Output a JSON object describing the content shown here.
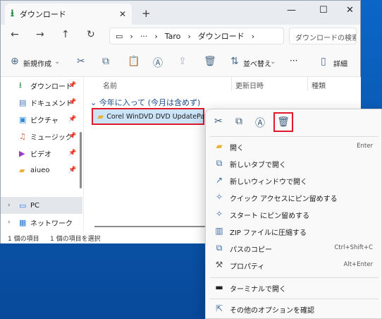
{
  "window": {
    "tab_title": "ダウンロード",
    "new_tab": "+",
    "controls": {
      "minimize": "—",
      "maximize": "☐",
      "close": "✕"
    }
  },
  "nav": {
    "breadcrumb": [
      "Taro",
      "ダウンロード"
    ],
    "more": "···",
    "search_placeholder": "ダウンロードの検索"
  },
  "toolbar": {
    "new_label": "新規作成",
    "sort_label": "並べ替え",
    "more": "···",
    "details_label": "詳細"
  },
  "sidebar": {
    "items": [
      {
        "label": "ダウンロード",
        "icon": "download-icon"
      },
      {
        "label": "ドキュメント",
        "icon": "document-icon"
      },
      {
        "label": "ピクチャ",
        "icon": "picture-icon"
      },
      {
        "label": "ミュージック",
        "icon": "music-icon"
      },
      {
        "label": "ビデオ",
        "icon": "video-icon"
      },
      {
        "label": "aiueo",
        "icon": "folder-icon"
      },
      {
        "label": "PC",
        "icon": "pc-icon"
      },
      {
        "label": "ネットワーク",
        "icon": "network-icon"
      }
    ]
  },
  "content": {
    "columns": [
      "名前",
      "更新日時",
      "種類"
    ],
    "group": "今年に入って (今月は含めず)",
    "file": "Corel WinDVD DVD UpdatePatch"
  },
  "status": {
    "count": "1 個の項目",
    "selected": "1 個の項目を選択"
  },
  "context_menu": {
    "items": [
      {
        "label": "開く",
        "shortcut": "Enter",
        "icon": "open-folder-icon"
      },
      {
        "label": "新しいタブで開く",
        "shortcut": "",
        "icon": "new-tab-icon"
      },
      {
        "label": "新しいウィンドウで開く",
        "shortcut": "",
        "icon": "new-window-icon"
      },
      {
        "label": "クイック アクセスにピン留めする",
        "shortcut": "",
        "icon": "pin-icon"
      },
      {
        "label": "スタート にピン留めする",
        "shortcut": "",
        "icon": "pin-start-icon"
      },
      {
        "label": "ZIP ファイルに圧縮する",
        "shortcut": "",
        "icon": "zip-icon"
      },
      {
        "label": "パスのコピー",
        "shortcut": "Ctrl+Shift+C",
        "icon": "copy-path-icon"
      },
      {
        "label": "プロパティ",
        "shortcut": "Alt+Enter",
        "icon": "properties-icon"
      },
      {
        "label": "ターミナルで開く",
        "shortcut": "",
        "icon": "terminal-icon"
      },
      {
        "label": "その他のオプションを確認",
        "shortcut": "",
        "icon": "more-options-icon"
      }
    ]
  }
}
